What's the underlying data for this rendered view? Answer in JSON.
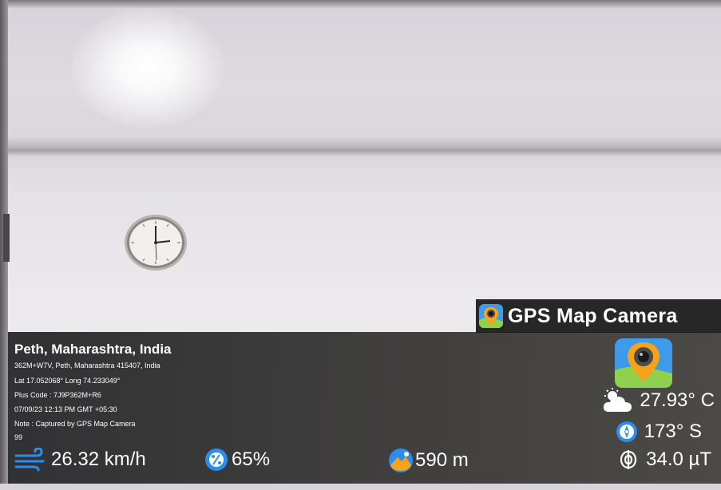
{
  "brand": {
    "label": "GPS Map Camera"
  },
  "location": {
    "title": "Peth, Maharashtra, India",
    "address": "362M+W7V, Peth, Maharashtra 415407, India",
    "coordinates": "Lat 17.052068° Long 74.233049°",
    "plus_code": "Plus Code : 7J9P362M+R6",
    "datetime": "07/09/23 12:13 PM GMT +05:30",
    "note": "Note : Captured by GPS Map Camera",
    "extra": "99"
  },
  "stats": {
    "temperature": "27.93° C",
    "direction": "173° S",
    "wind": "26.32 km/h",
    "humidity": "65%",
    "altitude": "590 m",
    "magnetic": "34.0 µT"
  },
  "icons": {
    "brand": "gps-map-camera-app-icon",
    "weather": "cloud-sun-icon",
    "compass": "compass-icon",
    "wind": "wind-icon",
    "humidity": "humidity-percent-icon",
    "altitude": "altitude-icon",
    "magnetic": "magnet-field-icon"
  },
  "colors": {
    "overlay": "#2f2f30",
    "brand_text": "#ffffff",
    "icon_blue": "#2c8df0",
    "icon_orange": "#f6a21a"
  }
}
